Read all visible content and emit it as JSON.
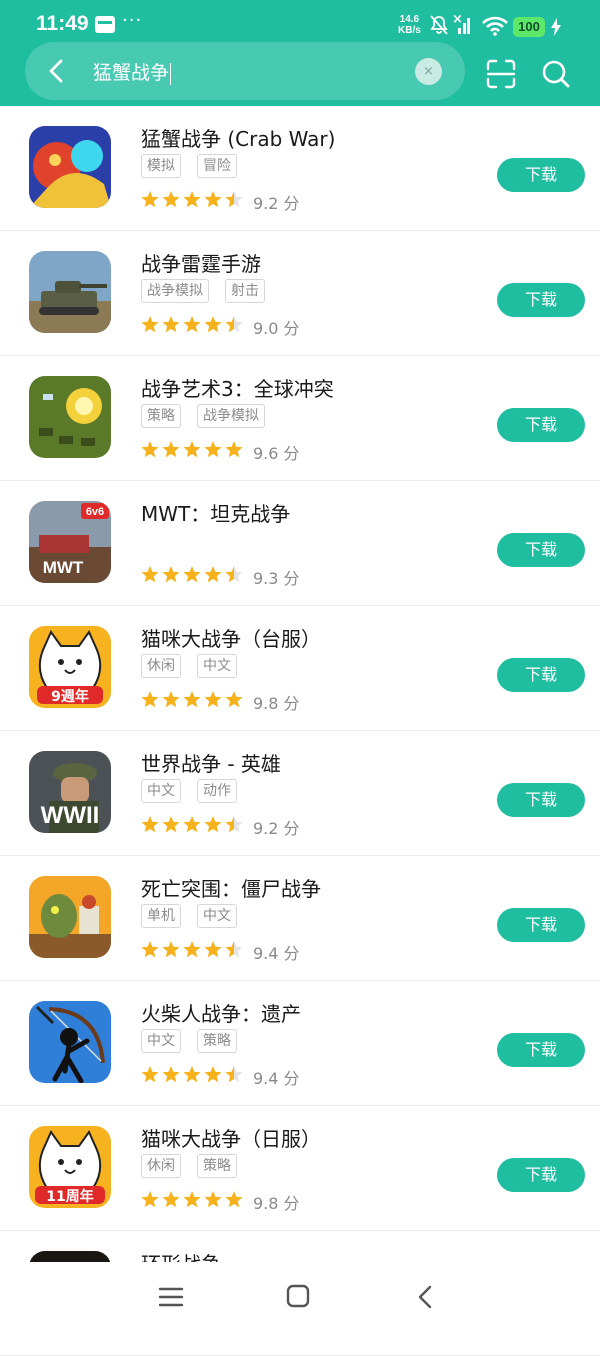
{
  "status_bar": {
    "time": "11:49",
    "more": "···",
    "net_speed_value": "14.6",
    "net_speed_unit": "KB/s",
    "signal_mark": "×",
    "battery": "100"
  },
  "search": {
    "query": "猛蟹战争",
    "clear_label": "×",
    "icons": [
      "back-icon",
      "clear-icon",
      "scan-icon",
      "search-icon"
    ]
  },
  "results": [
    {
      "name": "猛蟹战争 (Crab War)",
      "tags": [
        "模拟",
        "冒险"
      ],
      "score": "9.2 分",
      "rating": 4.5,
      "button": "下载"
    },
    {
      "name": "战争雷霆手游",
      "tags": [
        "战争模拟",
        "射击"
      ],
      "score": "9.0 分",
      "rating": 4.5,
      "button": "下载"
    },
    {
      "name": "战争艺术3：全球冲突",
      "tags": [
        "策略",
        "战争模拟"
      ],
      "score": "9.6 分",
      "rating": 5,
      "button": "下载"
    },
    {
      "name": "MWT：坦克战争",
      "tags": [],
      "score": "9.3 分",
      "rating": 4.5,
      "button": "下载",
      "icon_text": [
        "6v6",
        "MWT"
      ]
    },
    {
      "name": "猫咪大战争（台服）",
      "tags": [
        "休闲",
        "中文"
      ],
      "score": "9.8 分",
      "rating": 5,
      "button": "下载",
      "icon_text": [
        "9週年"
      ]
    },
    {
      "name": "世界战争 - 英雄",
      "tags": [
        "中文",
        "动作"
      ],
      "score": "9.2 分",
      "rating": 4.5,
      "button": "下载",
      "icon_text": [
        "WWII"
      ]
    },
    {
      "name": "死亡突围：僵尸战争",
      "tags": [
        "单机",
        "中文"
      ],
      "score": "9.4 分",
      "rating": 4.5,
      "button": "下载"
    },
    {
      "name": "火柴人战争：遗产",
      "tags": [
        "中文",
        "策略"
      ],
      "score": "9.4 分",
      "rating": 4.5,
      "button": "下载"
    },
    {
      "name": "猫咪大战争（日服）",
      "tags": [
        "休闲",
        "策略"
      ],
      "score": "9.8 分",
      "rating": 5,
      "button": "下载",
      "icon_text": [
        "11周年"
      ]
    },
    {
      "name": "环形战争",
      "tags": [],
      "score": "",
      "rating": 0,
      "button": ""
    }
  ],
  "colors": {
    "accent": "#20bea0",
    "star": "#f5b21c",
    "tag_border": "#d6d6d6"
  },
  "nav_bar": {
    "icons": [
      "menu-icon",
      "home-icon",
      "back-icon"
    ]
  }
}
